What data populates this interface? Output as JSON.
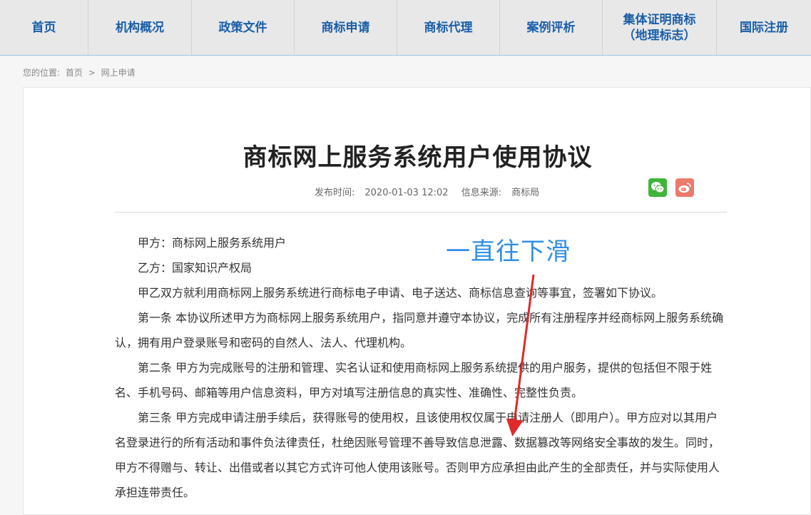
{
  "nav": {
    "items": [
      {
        "label": "首页"
      },
      {
        "label": "机构概况"
      },
      {
        "label": "政策文件"
      },
      {
        "label": "商标申请"
      },
      {
        "label": "商标代理"
      },
      {
        "label": "案例评析"
      },
      {
        "label": "集体证明商标\n（地理标志）"
      },
      {
        "label": "国际注册"
      }
    ]
  },
  "breadcrumb": {
    "prefix": "您的位置:",
    "home": "首页",
    "sep": ">",
    "current": "网上申请"
  },
  "article": {
    "title": "商标网上服务系统用户使用协议",
    "publish_label": "发布时间:",
    "publish_time": "2020-01-03 12:02",
    "source_label": "信息来源:",
    "source": "商标局",
    "paragraphs": [
      "甲方：商标网上服务系统用户",
      "乙方：国家知识产权局",
      "甲乙双方就利用商标网上服务系统进行商标电子申请、电子送达、商标信息查询等事宜，签署如下协议。",
      "第一条 本协议所述甲方为商标网上服务系统用户，指同意并遵守本协议，完成所有注册程序并经商标网上服务系统确认，拥有用户登录账号和密码的自然人、法人、代理机构。",
      "第二条 甲方为完成账号的注册和管理、实名认证和使用商标网上服务系统提供的用户服务，提供的包括但不限于姓名、手机号码、邮箱等用户信息资料，甲方对填写注册信息的真实性、准确性、完整性负责。",
      "第三条 甲方完成申请注册手续后，获得账号的使用权，且该使用权仅属于申请注册人（即用户）。甲方应对以其用户名登录进行的所有活动和事件负法律责任，杜绝因账号管理不善导致信息泄露、数据篡改等网络安全事故的发生。同时，甲方不得赠与、转让、出借或者以其它方式许可他人使用该账号。否则甲方应承担由此产生的全部责任，并与实际使用人承担连带责任。"
    ]
  },
  "annotation": {
    "text": "一直往下滑",
    "color": "#2f8ee8",
    "arrow_color": "#e02a2a"
  },
  "icons": {
    "wechat": "wechat-icon",
    "weibo": "weibo-icon"
  }
}
